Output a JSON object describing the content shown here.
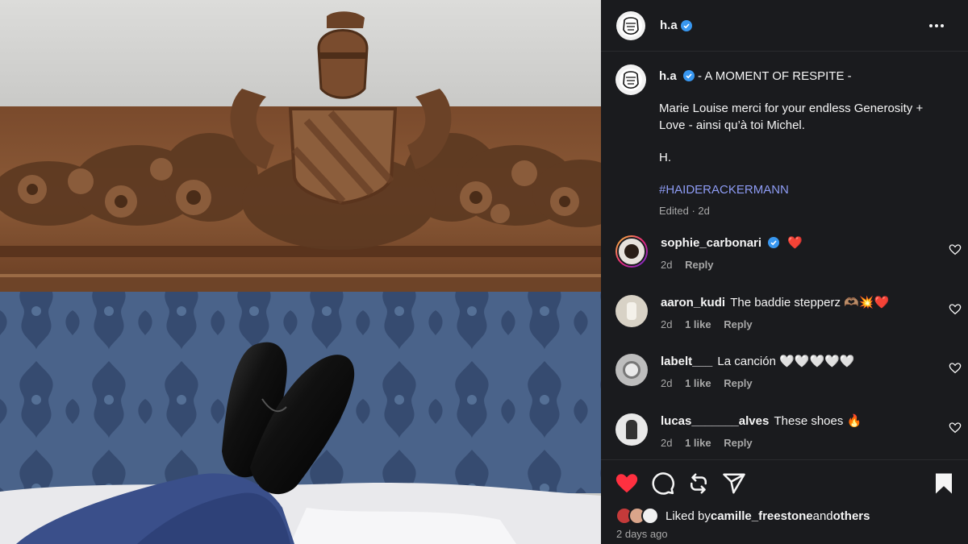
{
  "post": {
    "author": "h.a",
    "more_icon": "more-horizontal-icon",
    "caption": {
      "title": " - A MOMENT OF RESPITE -",
      "body": "Marie Louise merci for your endless Generosity + Love - ainsi qu’à toi Michel.",
      "signoff": "H.",
      "hashtag": "#HAIDERACKERMANN",
      "edited": "Edited · 2d"
    }
  },
  "comments": [
    {
      "user": "sophie_carbonari",
      "verified": true,
      "text": "❤️",
      "time": "2d",
      "likes": "",
      "reply": "Reply"
    },
    {
      "user": "aaron_kudi",
      "verified": false,
      "text": "The baddie stepperz 🫶🏽💥❤️",
      "time": "2d",
      "likes": "1 like",
      "reply": "Reply"
    },
    {
      "user": "labelt___",
      "verified": false,
      "text": "La canción 🤍🤍🤍🤍🤍",
      "time": "2d",
      "likes": "1 like",
      "reply": "Reply"
    },
    {
      "user": "lucas_______alves",
      "verified": false,
      "text": "These shoes 🔥",
      "time": "2d",
      "likes": "1 like",
      "reply": "Reply"
    }
  ],
  "actions": {
    "like_icon": "heart-filled-icon",
    "comment_icon": "comment-icon",
    "repost_icon": "repost-icon",
    "share_icon": "share-icon",
    "save_icon": "bookmark-filled-icon"
  },
  "likes": {
    "prefix": "Liked by ",
    "user": "camille_freestone",
    "and": " and ",
    "others": "others"
  },
  "posted": "2 days ago",
  "colors": {
    "heart": "#ff3040",
    "verified": "#3897f0",
    "hashtag": "#8e9cf5",
    "panel": "#1a1b1e"
  }
}
